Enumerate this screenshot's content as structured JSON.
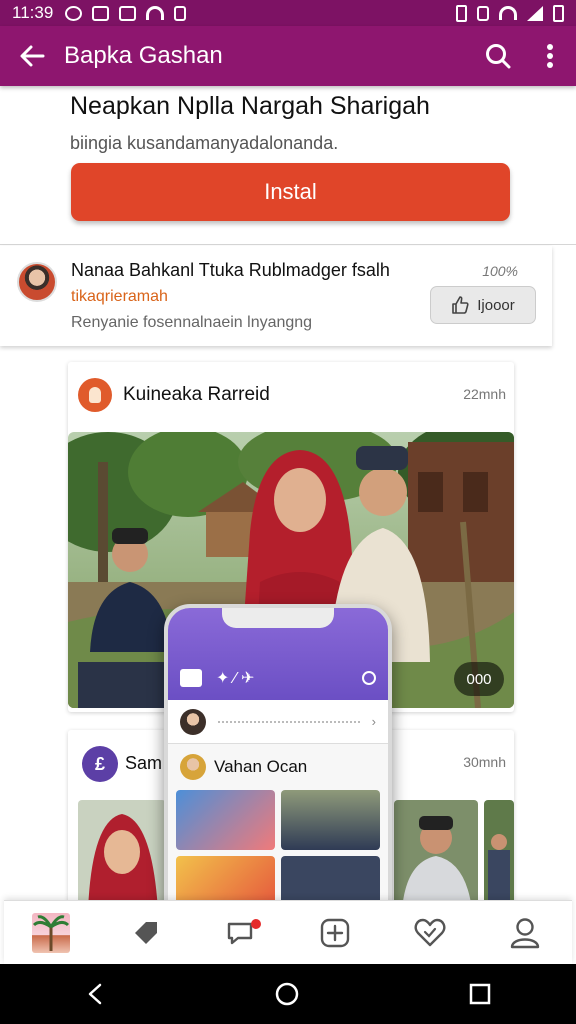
{
  "status_bar": {
    "time": "11:39"
  },
  "app_bar": {
    "title": "Bapka Gashan",
    "back_icon": "arrow-left-icon",
    "search_icon": "search-icon",
    "more_icon": "more-vert-icon"
  },
  "header": {
    "title": "Neapkan Nplla Nargah Sharigah",
    "subtitle": "biingia kusandamanyadalonanda.",
    "install_label": "Instal"
  },
  "notification": {
    "name": "Nanaa Bahkanl Ttuka Rublmadger fsalh",
    "meta": "100%",
    "tag": "tikaqrieramah",
    "description": "Renyanie fosennalnaein lnyangng",
    "like_label": "Ijooor"
  },
  "post1": {
    "author": "Kuineaka Rarreid",
    "time": "22mnh",
    "photo_count": "000"
  },
  "post2": {
    "author_initial": "£",
    "author": "Sam",
    "time": "30mnh"
  },
  "phone_mockup": {
    "user_name": "Vahan Ocan"
  },
  "bottom_nav": {
    "items": [
      "home-thumbnail",
      "tag-icon",
      "chat-icon",
      "add-square-icon",
      "heart-icon",
      "profile-icon"
    ]
  },
  "system_nav": {
    "items": [
      "back-icon",
      "home-icon",
      "recents-icon"
    ]
  },
  "colors": {
    "app_bar": "#8e166f",
    "status_bar": "#7d1264",
    "install_button": "#e04529",
    "accent_orange": "#d9641a"
  }
}
